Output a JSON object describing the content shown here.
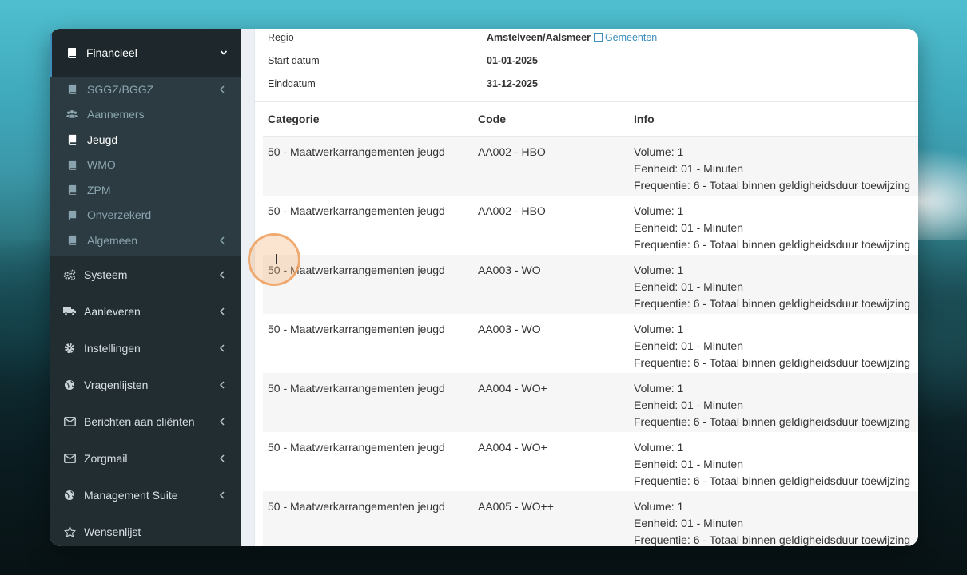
{
  "sidebar": {
    "section": {
      "label": "Financieel",
      "icon": "book-icon"
    },
    "subitems": [
      {
        "label": "SGGZ/BGGZ",
        "icon": "book-icon",
        "has_chevron": true
      },
      {
        "label": "Aannemers",
        "icon": "users-icon",
        "has_chevron": false
      },
      {
        "label": "Jeugd",
        "icon": "book-icon",
        "has_chevron": false,
        "active": true
      },
      {
        "label": "WMO",
        "icon": "book-icon",
        "has_chevron": false
      },
      {
        "label": "ZPM",
        "icon": "book-icon",
        "has_chevron": false
      },
      {
        "label": "Onverzekerd",
        "icon": "book-icon",
        "has_chevron": false
      },
      {
        "label": "Algemeen",
        "icon": "book-icon",
        "has_chevron": true
      }
    ],
    "items": [
      {
        "label": "Systeem",
        "icon": "cogs-icon"
      },
      {
        "label": "Aanleveren",
        "icon": "truck-icon"
      },
      {
        "label": "Instellingen",
        "icon": "gear-icon"
      },
      {
        "label": "Vragenlijsten",
        "icon": "globe-icon"
      },
      {
        "label": "Berichten aan cliënten",
        "icon": "envelope-icon"
      },
      {
        "label": "Zorgmail",
        "icon": "envelope-icon"
      },
      {
        "label": "Management Suite",
        "icon": "globe-icon"
      },
      {
        "label": "Wensenlijst",
        "icon": "star-icon"
      }
    ]
  },
  "meta": {
    "regio_label": "Regio",
    "regio_value": "Amstelveen/Aalsmeer",
    "gemeenten_link": "Gemeenten",
    "start_label": "Start datum",
    "start_value": "01-01-2025",
    "eind_label": "Einddatum",
    "eind_value": "31-12-2025"
  },
  "table": {
    "headers": [
      "Categorie",
      "Code",
      "Info"
    ],
    "rows": [
      {
        "categorie": "50 - Maatwerkarrangementen jeugd",
        "code": "AA002 - HBO",
        "volume": "Volume: 1",
        "eenheid": "Eenheid: 01 - Minuten",
        "frequentie": "Frequentie: 6 - Totaal binnen geldigheidsduur toewijzing"
      },
      {
        "categorie": "50 - Maatwerkarrangementen jeugd",
        "code": "AA002 - HBO",
        "volume": "Volume: 1",
        "eenheid": "Eenheid: 01 - Minuten",
        "frequentie": "Frequentie: 6 - Totaal binnen geldigheidsduur toewijzing"
      },
      {
        "categorie": "50 - Maatwerkarrangementen jeugd",
        "code": "AA003 - WO",
        "volume": "Volume: 1",
        "eenheid": "Eenheid: 01 - Minuten",
        "frequentie": "Frequentie: 6 - Totaal binnen geldigheidsduur toewijzing"
      },
      {
        "categorie": "50 - Maatwerkarrangementen jeugd",
        "code": "AA003 - WO",
        "volume": "Volume: 1",
        "eenheid": "Eenheid: 01 - Minuten",
        "frequentie": "Frequentie: 6 - Totaal binnen geldigheidsduur toewijzing"
      },
      {
        "categorie": "50 - Maatwerkarrangementen jeugd",
        "code": "AA004 - WO+",
        "volume": "Volume: 1",
        "eenheid": "Eenheid: 01 - Minuten",
        "frequentie": "Frequentie: 6 - Totaal binnen geldigheidsduur toewijzing"
      },
      {
        "categorie": "50 - Maatwerkarrangementen jeugd",
        "code": "AA004 - WO+",
        "volume": "Volume: 1",
        "eenheid": "Eenheid: 01 - Minuten",
        "frequentie": "Frequentie: 6 - Totaal binnen geldigheidsduur toewijzing"
      },
      {
        "categorie": "50 - Maatwerkarrangementen jeugd",
        "code": "AA005 - WO++",
        "volume": "Volume: 1",
        "eenheid": "Eenheid: 01 - Minuten",
        "frequentie": "Frequentie: 6 - Totaal binnen geldigheidsduur toewijzing"
      }
    ]
  }
}
